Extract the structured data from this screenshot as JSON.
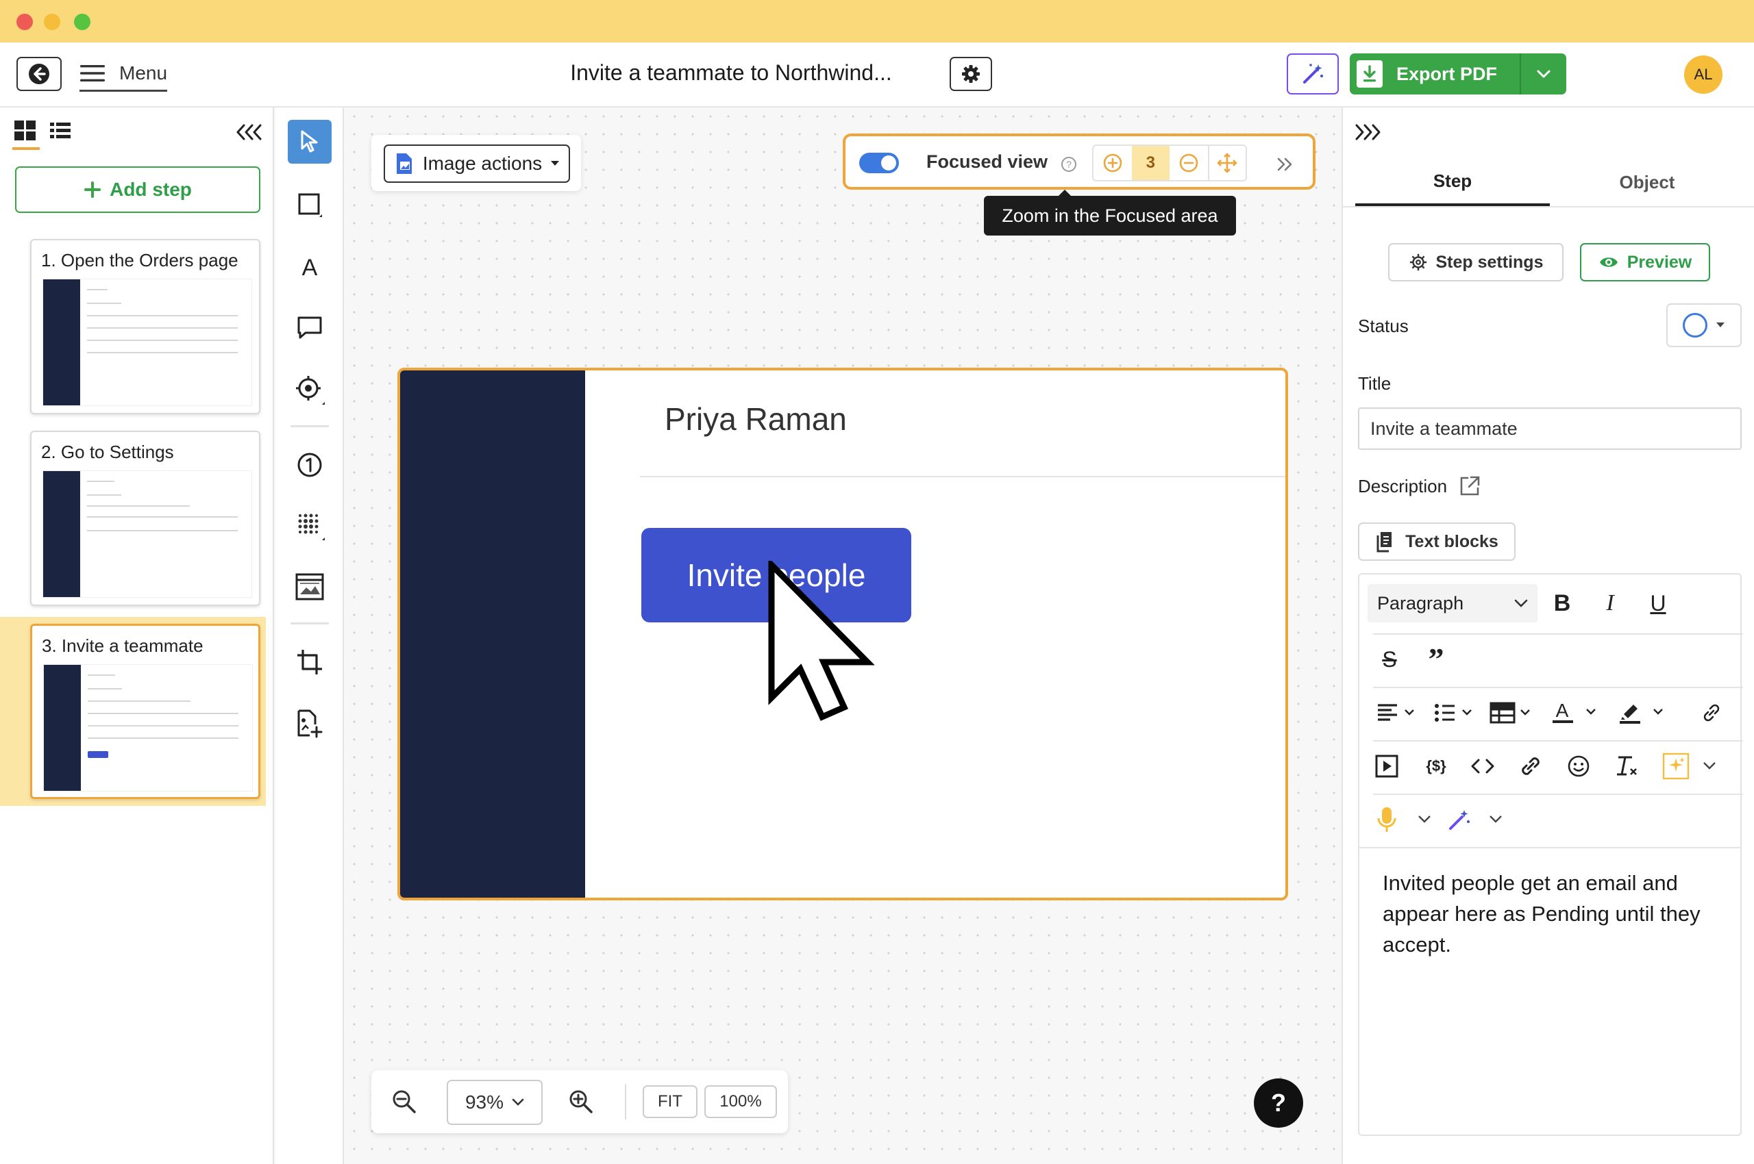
{
  "window": {
    "traffic_colors": [
      "#ef5b54",
      "#f6bd3a",
      "#56c341"
    ],
    "title_bar_color": "#fad97a"
  },
  "header": {
    "menu_label": "Menu",
    "document_title": "Invite a teammate to Northwind...",
    "export_label": "Export PDF",
    "avatar_initials": "AL",
    "export_color": "#3aa547",
    "magic_color": "#7a4cf0"
  },
  "left_panel": {
    "add_step_label": "Add step",
    "steps": [
      {
        "title": "1. Open the Orders page"
      },
      {
        "title": "2. Go to Settings"
      },
      {
        "title": "3. Invite a teammate"
      }
    ],
    "selected_step_index": 2
  },
  "toolbar": {
    "tools": [
      "pointer-tool",
      "rectangle-tool",
      "text-tool",
      "comment-tool",
      "hotspot-tool",
      "number-tool",
      "blur-tool",
      "image-tool",
      "crop-tool",
      "add-image-tool"
    ]
  },
  "canvas": {
    "image_actions_label": "Image actions",
    "focused_view_label": "Focused view",
    "focused_zoom_level": "3",
    "tooltip": "Zoom in the Focused area",
    "screenshot": {
      "name": "Priya Raman",
      "button_label": "Invite people"
    },
    "zoom_value": "93%",
    "fit_label": "FIT",
    "hundred_label": "100%",
    "help_label": "?"
  },
  "right_panel": {
    "tabs": [
      {
        "label": "Step"
      },
      {
        "label": "Object"
      }
    ],
    "active_tab": "Step",
    "step_settings_label": "Step settings",
    "preview_label": "Preview",
    "status_label": "Status",
    "title_label": "Title",
    "title_value": "Invite a teammate",
    "description_label": "Description",
    "text_blocks_label": "Text blocks",
    "paragraph_select": "Paragraph",
    "editor_text": "Invited people get an email and appear here as Pending until they accept."
  },
  "colors": {
    "accent_orange": "#eea53a",
    "brand_blue": "#3d52cc",
    "screenshot_sidebar": "#1b2440",
    "green": "#2e9e49"
  }
}
